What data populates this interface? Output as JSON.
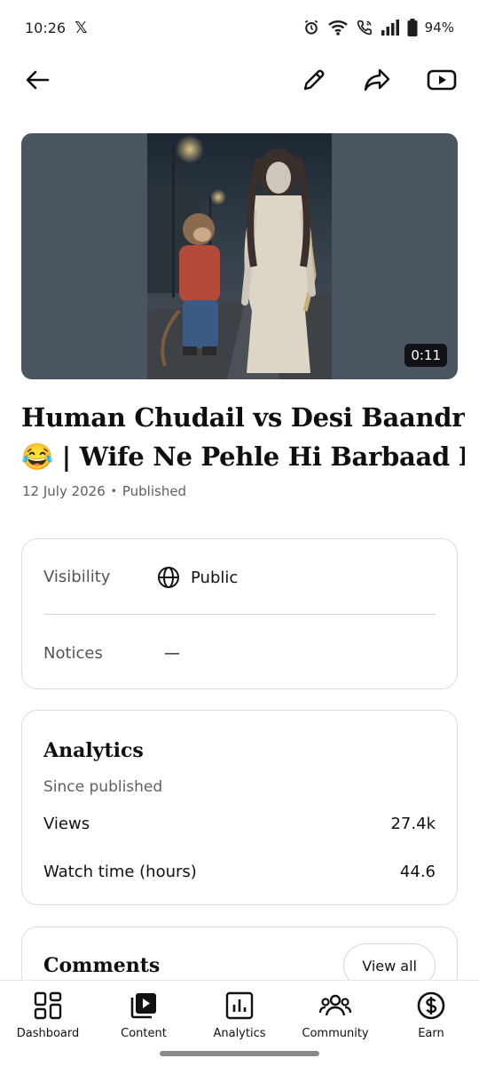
{
  "status_bar": {
    "time": "10:26",
    "x_app": "𝕏",
    "battery": "94%"
  },
  "video": {
    "duration": "0:11",
    "title_line1": "Human Chudail vs Desi Baandru",
    "title_line2": "😂 | Wife Ne Pehle Hi Barbaad K..",
    "date": "12 July 2026",
    "status": "Published"
  },
  "details": {
    "visibility_label": "Visibility",
    "visibility_value": "Public",
    "notices_label": "Notices",
    "notices_value": "—"
  },
  "analytics": {
    "title": "Analytics",
    "subtitle": "Since published",
    "stats": [
      {
        "label": "Views",
        "value": "27.4k"
      },
      {
        "label": "Watch time (hours)",
        "value": "44.6"
      }
    ]
  },
  "comments": {
    "title": "Comments",
    "view_all": "View all"
  },
  "nav": [
    {
      "label": "Dashboard",
      "icon": "dashboard-icon"
    },
    {
      "label": "Content",
      "icon": "content-icon"
    },
    {
      "label": "Analytics",
      "icon": "analytics-icon"
    },
    {
      "label": "Community",
      "icon": "community-icon"
    },
    {
      "label": "Earn",
      "icon": "earn-icon"
    }
  ]
}
